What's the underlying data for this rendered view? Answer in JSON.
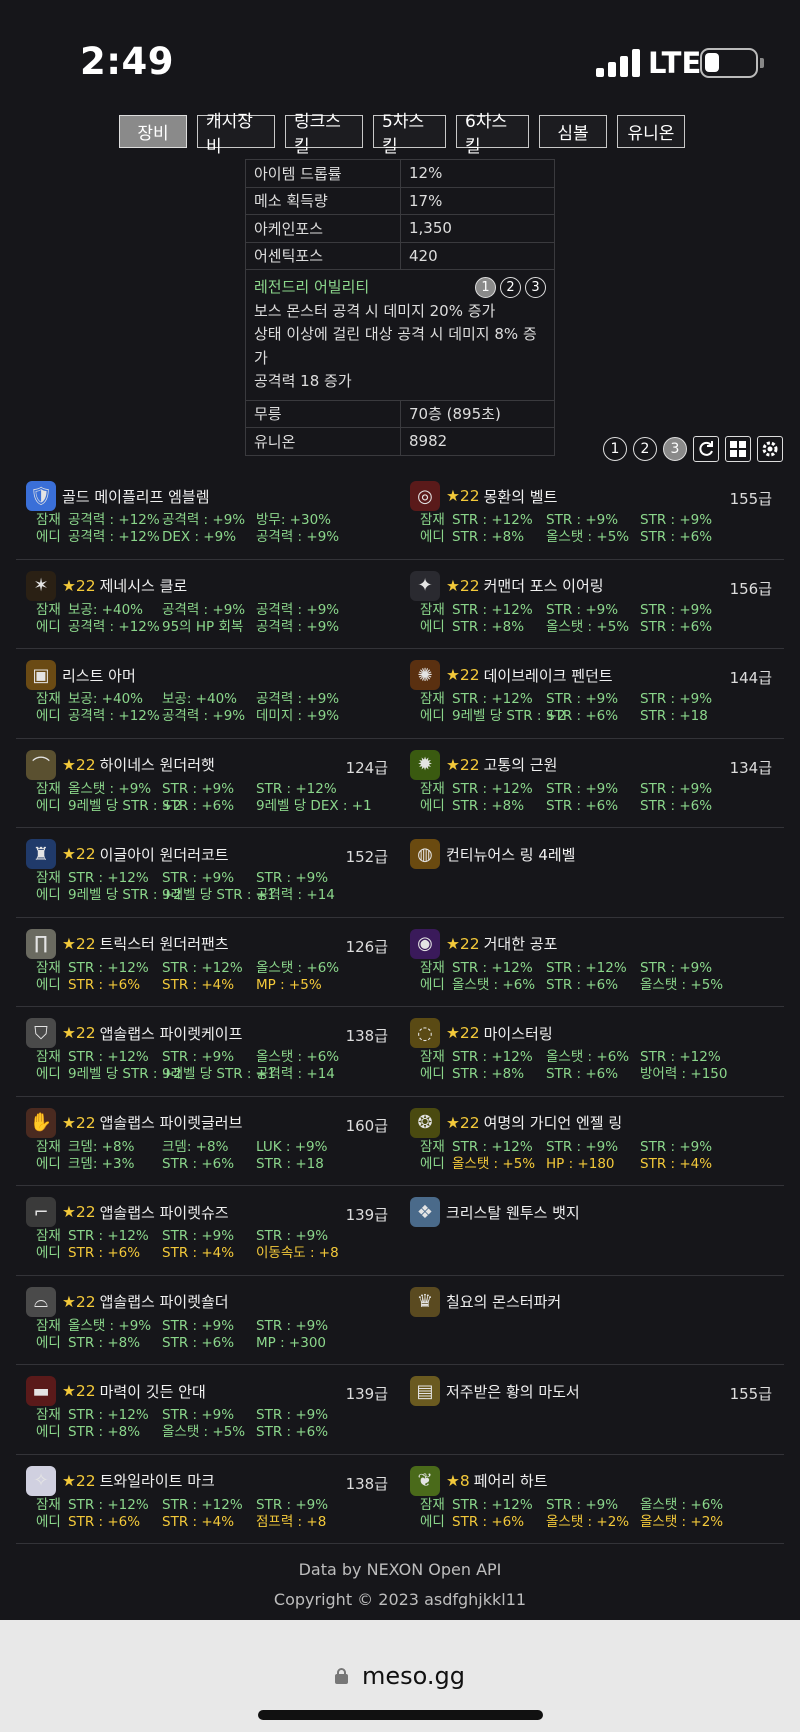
{
  "status": {
    "time": "2:49",
    "network": "LTE"
  },
  "tabs": [
    "장비",
    "캐시장비",
    "링크스킬",
    "5차스킬",
    "6차스킬",
    "심볼",
    "유니온"
  ],
  "stats": {
    "rows_top": [
      {
        "k": "아이템 드롭률",
        "v": "12%"
      },
      {
        "k": "메소 획득량",
        "v": "17%"
      },
      {
        "k": "아케인포스",
        "v": "1,350"
      },
      {
        "k": "어센틱포스",
        "v": "420"
      }
    ],
    "legendary": {
      "title": "레전드리 어빌리티",
      "lines": [
        "보스 몬스터 공격 시 데미지 20% 증가",
        "상태 이상에 걸린 대상 공격 시 데미지 8% 증가",
        "공격력 18 증가"
      ],
      "pages": [
        "1",
        "2",
        "3"
      ]
    },
    "rows_bottom": [
      {
        "k": "무릉",
        "v": "70층 (895초)"
      },
      {
        "k": "유니온",
        "v": "8982"
      }
    ]
  },
  "tools": {
    "presets": [
      "1",
      "2",
      "3"
    ]
  },
  "items": [
    {
      "name": "골드 메이플리프 엠블렘",
      "star": "",
      "level": "",
      "icon": "🛡",
      "bg": "#3a6fd8",
      "pot": [
        [
          "공격력 : +12%",
          "g"
        ],
        [
          "공격력 : +9%",
          "g"
        ],
        [
          "방무: +30%",
          "g"
        ]
      ],
      "add": [
        [
          "공격력 : +12%",
          "g"
        ],
        [
          "DEX : +9%",
          "g"
        ],
        [
          "공격력 : +9%",
          "g"
        ]
      ]
    },
    {
      "name": "몽환의 벨트",
      "star": "★22",
      "level": "155급",
      "icon": "◎",
      "bg": "#5a1a1a",
      "pot": [
        [
          "STR : +12%",
          "g"
        ],
        [
          "STR : +9%",
          "g"
        ],
        [
          "STR : +9%",
          "g"
        ]
      ],
      "add": [
        [
          "STR : +8%",
          "g"
        ],
        [
          "올스탯 : +5%",
          "g"
        ],
        [
          "STR : +6%",
          "g"
        ]
      ]
    },
    {
      "name": "제네시스 클로",
      "star": "★22",
      "level": "",
      "icon": "✶",
      "bg": "#2a2014",
      "pot": [
        [
          "보공: +40%",
          "g"
        ],
        [
          "공격력 : +9%",
          "g"
        ],
        [
          "공격력 : +9%",
          "g"
        ]
      ],
      "add": [
        [
          "공격력 : +12%",
          "g"
        ],
        [
          "95의 HP 회복",
          "g"
        ],
        [
          "공격력 : +9%",
          "g"
        ]
      ]
    },
    {
      "name": "커맨더 포스 이어링",
      "star": "★22",
      "level": "156급",
      "icon": "✦",
      "bg": "#2a2a30",
      "pot": [
        [
          "STR : +12%",
          "g"
        ],
        [
          "STR : +9%",
          "g"
        ],
        [
          "STR : +9%",
          "g"
        ]
      ],
      "add": [
        [
          "STR : +8%",
          "g"
        ],
        [
          "올스탯 : +5%",
          "g"
        ],
        [
          "STR : +6%",
          "g"
        ]
      ]
    },
    {
      "name": "리스트 아머",
      "star": "",
      "level": "",
      "icon": "▣",
      "bg": "#6a4a14",
      "pot": [
        [
          "보공: +40%",
          "g"
        ],
        [
          "보공: +40%",
          "g"
        ],
        [
          "공격력 : +9%",
          "g"
        ]
      ],
      "add": [
        [
          "공격력 : +12%",
          "g"
        ],
        [
          "공격력 : +9%",
          "g"
        ],
        [
          "데미지 : +9%",
          "g"
        ]
      ]
    },
    {
      "name": "데이브레이크 펜던트",
      "star": "★22",
      "level": "144급",
      "icon": "✺",
      "bg": "#5a3010",
      "pot": [
        [
          "STR : +12%",
          "g"
        ],
        [
          "STR : +9%",
          "g"
        ],
        [
          "STR : +9%",
          "g"
        ]
      ],
      "add": [
        [
          "9레벨 당 STR : +2",
          "g"
        ],
        [
          "STR : +6%",
          "g"
        ],
        [
          "STR : +18",
          "g"
        ]
      ]
    },
    {
      "name": "하이네스 원더러햇",
      "star": "★22",
      "level": "124급",
      "icon": "⌒",
      "bg": "#5a5030",
      "pot": [
        [
          "올스탯 : +9%",
          "g"
        ],
        [
          "STR : +9%",
          "g"
        ],
        [
          "STR : +12%",
          "g"
        ]
      ],
      "add": [
        [
          "9레벨 당 STR : +2",
          "g"
        ],
        [
          "STR : +6%",
          "g"
        ],
        [
          "9레벨 당 DEX : +1",
          "g"
        ]
      ]
    },
    {
      "name": "고통의 근원",
      "star": "★22",
      "level": "134급",
      "icon": "✹",
      "bg": "#3a5a10",
      "pot": [
        [
          "STR : +12%",
          "g"
        ],
        [
          "STR : +9%",
          "g"
        ],
        [
          "STR : +9%",
          "g"
        ]
      ],
      "add": [
        [
          "STR : +8%",
          "g"
        ],
        [
          "STR : +6%",
          "g"
        ],
        [
          "STR : +6%",
          "g"
        ]
      ]
    },
    {
      "name": "이글아이 원더러코트",
      "star": "★22",
      "level": "152급",
      "icon": "♜",
      "bg": "#203a6a",
      "pot": [
        [
          "STR : +12%",
          "g"
        ],
        [
          "STR : +9%",
          "g"
        ],
        [
          "STR : +9%",
          "g"
        ]
      ],
      "add": [
        [
          "9레벨 당 STR : +2",
          "g"
        ],
        [
          "9레벨 당 STR : +1",
          "g"
        ],
        [
          "공격력 : +14",
          "g"
        ]
      ]
    },
    {
      "name": "컨티뉴어스 링 4레벨",
      "star": "",
      "level": "",
      "icon": "◍",
      "bg": "#6a4a10",
      "pot": [],
      "add": []
    },
    {
      "name": "트릭스터 원더러팬츠",
      "star": "★22",
      "level": "126급",
      "icon": "∏",
      "bg": "#6a6a60",
      "pot": [
        [
          "STR : +12%",
          "g"
        ],
        [
          "STR : +12%",
          "g"
        ],
        [
          "올스탯 : +6%",
          "g"
        ]
      ],
      "add": [
        [
          "STR : +6%",
          "y"
        ],
        [
          "STR : +4%",
          "y"
        ],
        [
          "MP : +5%",
          "y"
        ]
      ]
    },
    {
      "name": "거대한 공포",
      "star": "★22",
      "level": "",
      "icon": "◉",
      "bg": "#3a1a5a",
      "pot": [
        [
          "STR : +12%",
          "g"
        ],
        [
          "STR : +12%",
          "g"
        ],
        [
          "STR : +9%",
          "g"
        ]
      ],
      "add": [
        [
          "올스탯 : +6%",
          "g"
        ],
        [
          "STR : +6%",
          "g"
        ],
        [
          "올스탯 : +5%",
          "g"
        ]
      ]
    },
    {
      "name": "앱솔랩스 파이렛케이프",
      "star": "★22",
      "level": "138급",
      "icon": "⛉",
      "bg": "#4a4a4a",
      "pot": [
        [
          "STR : +12%",
          "g"
        ],
        [
          "STR : +9%",
          "g"
        ],
        [
          "올스탯 : +6%",
          "g"
        ]
      ],
      "add": [
        [
          "9레벨 당 STR : +2",
          "g"
        ],
        [
          "9레벨 당 STR : +1",
          "g"
        ],
        [
          "공격력 : +14",
          "g"
        ]
      ]
    },
    {
      "name": "마이스터링",
      "star": "★22",
      "level": "",
      "icon": "◌",
      "bg": "#5a4a14",
      "pot": [
        [
          "STR : +12%",
          "g"
        ],
        [
          "올스탯 : +6%",
          "g"
        ],
        [
          "STR : +12%",
          "g"
        ]
      ],
      "add": [
        [
          "STR : +8%",
          "g"
        ],
        [
          "STR : +6%",
          "g"
        ],
        [
          "방어력 : +150",
          "g"
        ]
      ]
    },
    {
      "name": "앱솔랩스 파이렛글러브",
      "star": "★22",
      "level": "160급",
      "icon": "✋",
      "bg": "#4a2a20",
      "pot": [
        [
          "크뎀: +8%",
          "g"
        ],
        [
          "크뎀: +8%",
          "g"
        ],
        [
          "LUK : +9%",
          "g"
        ]
      ],
      "add": [
        [
          "크뎀: +3%",
          "g"
        ],
        [
          "STR : +6%",
          "g"
        ],
        [
          "STR : +18",
          "g"
        ]
      ]
    },
    {
      "name": "여명의 가디언 엔젤 링",
      "star": "★22",
      "level": "",
      "icon": "❂",
      "bg": "#4a4a10",
      "pot": [
        [
          "STR : +12%",
          "g"
        ],
        [
          "STR : +9%",
          "g"
        ],
        [
          "STR : +9%",
          "g"
        ]
      ],
      "add": [
        [
          "올스탯 : +5%",
          "y"
        ],
        [
          "HP : +180",
          "y"
        ],
        [
          "STR : +4%",
          "y"
        ]
      ]
    },
    {
      "name": "앱솔랩스 파이렛슈즈",
      "star": "★22",
      "level": "139급",
      "icon": "⌐",
      "bg": "#3a3a3a",
      "pot": [
        [
          "STR : +12%",
          "g"
        ],
        [
          "STR : +9%",
          "g"
        ],
        [
          "STR : +9%",
          "g"
        ]
      ],
      "add": [
        [
          "STR : +6%",
          "y"
        ],
        [
          "STR : +4%",
          "y"
        ],
        [
          "이동속도 : +8",
          "y"
        ]
      ]
    },
    {
      "name": "크리스탈 웬투스 뱃지",
      "star": "",
      "level": "",
      "icon": "❖",
      "bg": "#4a6a8a",
      "pot": [],
      "add": []
    },
    {
      "name": "앱솔랩스 파이렛숄더",
      "star": "★22",
      "level": "",
      "icon": "⌓",
      "bg": "#4a4a4a",
      "pot": [
        [
          "올스탯 : +9%",
          "g"
        ],
        [
          "STR : +9%",
          "g"
        ],
        [
          "STR : +9%",
          "g"
        ]
      ],
      "add": [
        [
          "STR : +8%",
          "g"
        ],
        [
          "STR : +6%",
          "g"
        ],
        [
          "MP : +300",
          "g"
        ]
      ]
    },
    {
      "name": "칠요의 몬스터파커",
      "star": "",
      "level": "",
      "icon": "♛",
      "bg": "#5a4a20",
      "pot": [],
      "add": []
    },
    {
      "name": "마력이 깃든 안대",
      "star": "★22",
      "level": "139급",
      "icon": "▬",
      "bg": "#5a1a1a",
      "pot": [
        [
          "STR : +12%",
          "g"
        ],
        [
          "STR : +9%",
          "g"
        ],
        [
          "STR : +9%",
          "g"
        ]
      ],
      "add": [
        [
          "STR : +8%",
          "g"
        ],
        [
          "올스탯 : +5%",
          "g"
        ],
        [
          "STR : +6%",
          "g"
        ]
      ]
    },
    {
      "name": "저주받은 황의 마도서",
      "star": "",
      "level": "155급",
      "icon": "▤",
      "bg": "#6a5a20",
      "pot": [],
      "add": []
    },
    {
      "name": "트와일라이트 마크",
      "star": "★22",
      "level": "138급",
      "icon": "✧",
      "bg": "#d0d0e0",
      "pot": [
        [
          "STR : +12%",
          "g"
        ],
        [
          "STR : +12%",
          "g"
        ],
        [
          "STR : +9%",
          "g"
        ]
      ],
      "add": [
        [
          "STR : +6%",
          "y"
        ],
        [
          "STR : +4%",
          "y"
        ],
        [
          "점프력 : +8",
          "y"
        ]
      ]
    },
    {
      "name": "페어리 하트",
      "star": "★8",
      "level": "",
      "icon": "❦",
      "bg": "#4a6a1a",
      "pot": [
        [
          "STR : +12%",
          "g"
        ],
        [
          "STR : +9%",
          "g"
        ],
        [
          "올스탯 : +6%",
          "g"
        ]
      ],
      "add": [
        [
          "STR : +6%",
          "y"
        ],
        [
          "올스탯 : +2%",
          "y"
        ],
        [
          "올스탯 : +2%",
          "y"
        ]
      ]
    }
  ],
  "labels": {
    "potential": "잠재",
    "additional": "에디"
  },
  "footer": {
    "line1": "Data by NEXON Open API",
    "line2": "Copyright © 2023 asdfghjkkl11"
  },
  "browser": {
    "url": "meso.gg"
  }
}
